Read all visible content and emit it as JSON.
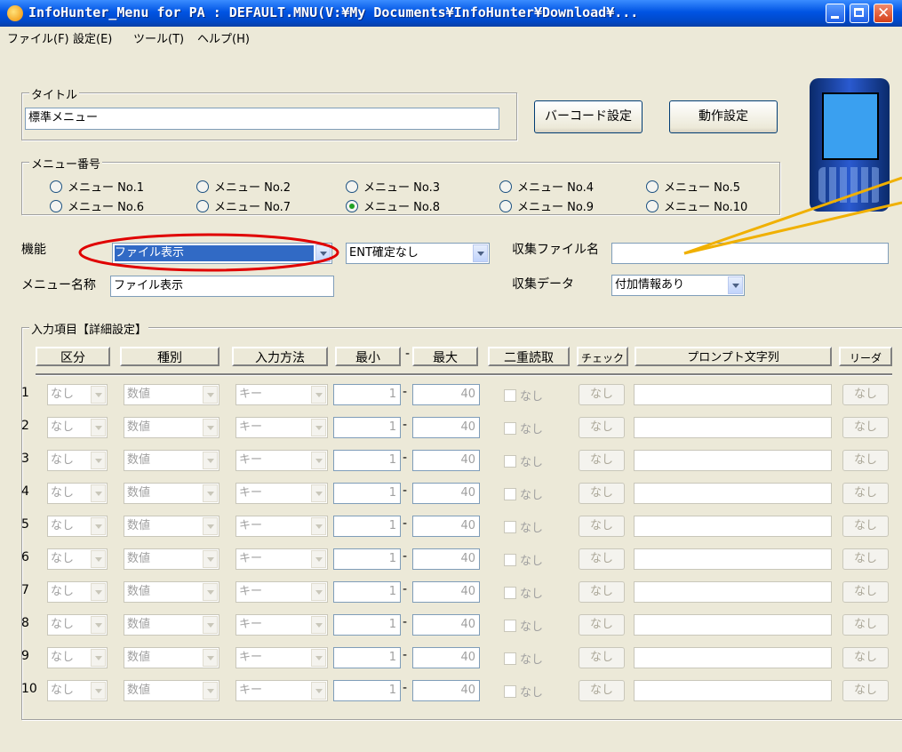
{
  "window": {
    "title": "InfoHunter_Menu for PA : DEFAULT.MNU(V:¥My Documents¥InfoHunter¥Download¥..."
  },
  "menubar": [
    "ファイル(F)",
    "設定(E)",
    "ツール(T)",
    "ヘルプ(H)"
  ],
  "title_group": {
    "legend": "タイトル",
    "value": "標準メニュー"
  },
  "buttons": {
    "barcode": "バーコード設定",
    "operation": "動作設定"
  },
  "menu_number": {
    "legend": "メニュー番号",
    "options": [
      "メニュー No.1",
      "メニュー No.2",
      "メニュー No.3",
      "メニュー No.4",
      "メニュー No.5",
      "メニュー No.6",
      "メニュー No.7",
      "メニュー No.8",
      "メニュー No.9",
      "メニュー No.10"
    ],
    "selected": "メニュー No.8"
  },
  "function": {
    "label": "機能",
    "value": "ファイル表示",
    "ent_value": "ENT確定なし"
  },
  "collect_file": {
    "label": "収集ファイル名",
    "value": ""
  },
  "menu_name": {
    "label": "メニュー名称",
    "value": "ファイル表示"
  },
  "collect_data": {
    "label": "収集データ",
    "value": "付加情報あり"
  },
  "input_items": {
    "legend": "入力項目【詳細設定】",
    "headers": {
      "kubun": "区分",
      "shubetsu": "種別",
      "method": "入力方法",
      "min": "最小",
      "dash": "-",
      "max": "最大",
      "double": "二重読取",
      "check": "チェック",
      "prompt": "プロンプト文字列",
      "reader": "リーダ"
    },
    "rows": [
      {
        "n": "1",
        "kubun": "なし",
        "type": "数値",
        "method": "キー",
        "min": "1",
        "max": "40",
        "double": "なし",
        "check": "なし",
        "prompt": "",
        "reader": "なし"
      },
      {
        "n": "2",
        "kubun": "なし",
        "type": "数値",
        "method": "キー",
        "min": "1",
        "max": "40",
        "double": "なし",
        "check": "なし",
        "prompt": "",
        "reader": "なし"
      },
      {
        "n": "3",
        "kubun": "なし",
        "type": "数値",
        "method": "キー",
        "min": "1",
        "max": "40",
        "double": "なし",
        "check": "なし",
        "prompt": "",
        "reader": "なし"
      },
      {
        "n": "4",
        "kubun": "なし",
        "type": "数値",
        "method": "キー",
        "min": "1",
        "max": "40",
        "double": "なし",
        "check": "なし",
        "prompt": "",
        "reader": "なし"
      },
      {
        "n": "5",
        "kubun": "なし",
        "type": "数値",
        "method": "キー",
        "min": "1",
        "max": "40",
        "double": "なし",
        "check": "なし",
        "prompt": "",
        "reader": "なし"
      },
      {
        "n": "6",
        "kubun": "なし",
        "type": "数値",
        "method": "キー",
        "min": "1",
        "max": "40",
        "double": "なし",
        "check": "なし",
        "prompt": "",
        "reader": "なし"
      },
      {
        "n": "7",
        "kubun": "なし",
        "type": "数値",
        "method": "キー",
        "min": "1",
        "max": "40",
        "double": "なし",
        "check": "なし",
        "prompt": "",
        "reader": "なし"
      },
      {
        "n": "8",
        "kubun": "なし",
        "type": "数値",
        "method": "キー",
        "min": "1",
        "max": "40",
        "double": "なし",
        "check": "なし",
        "prompt": "",
        "reader": "なし"
      },
      {
        "n": "9",
        "kubun": "なし",
        "type": "数値",
        "method": "キー",
        "min": "1",
        "max": "40",
        "double": "なし",
        "check": "なし",
        "prompt": "",
        "reader": "なし"
      },
      {
        "n": "10",
        "kubun": "なし",
        "type": "数値",
        "method": "キー",
        "min": "1",
        "max": "40",
        "double": "なし",
        "check": "なし",
        "prompt": "",
        "reader": "なし"
      }
    ]
  },
  "colors": {
    "highlight_ellipse": "#e00000",
    "callout_lines": "#f0b000",
    "titlebar": "#0054e3",
    "selection": "#316ac5"
  }
}
